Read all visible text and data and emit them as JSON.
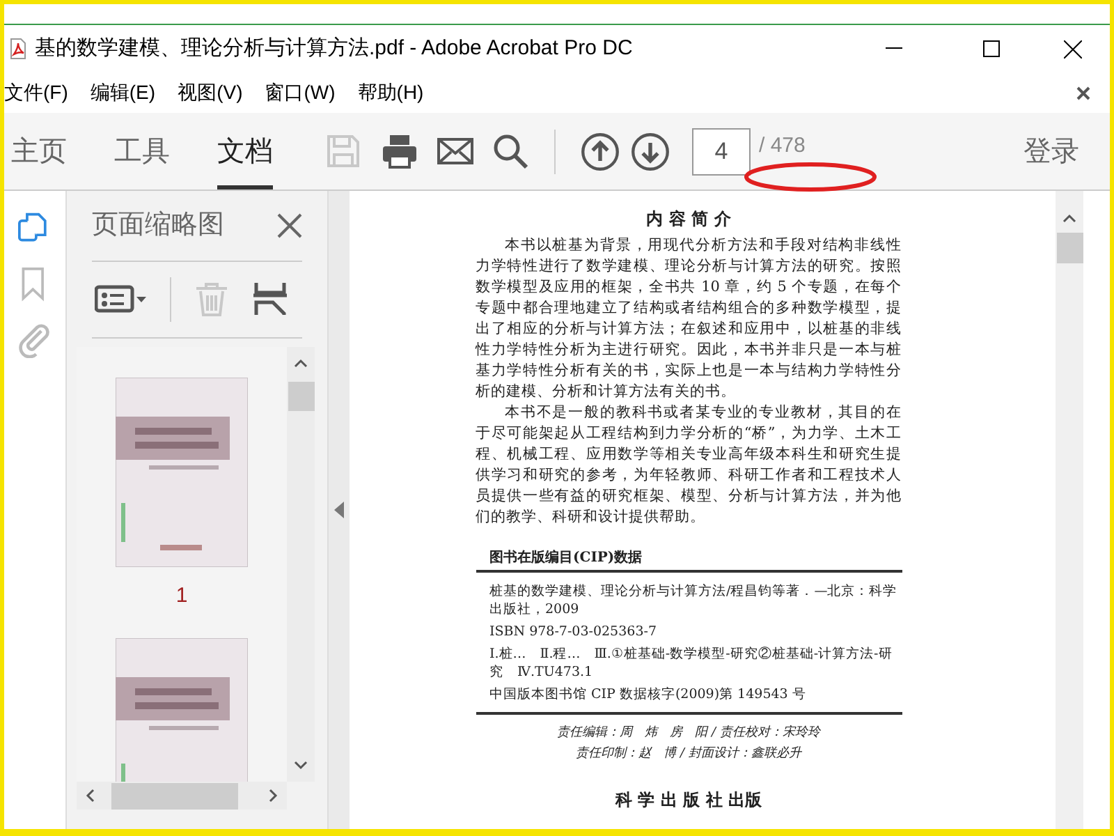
{
  "window": {
    "title": "基的数学建模、理论分析与计算方法.pdf - Adobe Acrobat Pro DC"
  },
  "menu": [
    {
      "label": "文件(F)"
    },
    {
      "label": "编辑(E)"
    },
    {
      "label": "视图(V)"
    },
    {
      "label": "窗口(W)"
    },
    {
      "label": "帮助(H)"
    }
  ],
  "toolbar": {
    "tabs": [
      {
        "label": "主页",
        "selected": false
      },
      {
        "label": "工具",
        "selected": false
      },
      {
        "label": "文档",
        "selected": true
      }
    ],
    "tools": [
      {
        "kind": "save",
        "disabled": true
      },
      {
        "kind": "print",
        "disabled": false
      },
      {
        "kind": "mail",
        "disabled": false
      },
      {
        "kind": "search",
        "disabled": false
      }
    ],
    "nav": [
      {
        "kind": "up"
      },
      {
        "kind": "down"
      }
    ],
    "page": {
      "current": "4",
      "total": "/ 478"
    },
    "sign_in": "登录"
  },
  "side_rail": [
    {
      "kind": "pages",
      "selected": true
    },
    {
      "kind": "bookmarks",
      "selected": false
    },
    {
      "kind": "attachments",
      "selected": false
    }
  ],
  "thumbnails_panel": {
    "title": "页面缩略图",
    "tools": [
      {
        "kind": "options",
        "disabled": false
      },
      {
        "kind": "delete",
        "disabled": true
      },
      {
        "kind": "extract",
        "disabled": false
      }
    ],
    "thumbnails": [
      {
        "kind": "picture",
        "label": "1"
      },
      {
        "kind": "picture"
      }
    ]
  },
  "document": {
    "heading": "内 容 简 介",
    "paragraphs": [
      "本书以桩基为背景，用现代分析方法和手段对结构非线性力学特性进行了数学建模、理论分析与计算方法的研究。按照数学模型及应用的框架，全书共 10 章，约 5 个专题，在每个专题中都合理地建立了结构或者结构组合的多种数学模型，提出了相应的分析与计算方法；在叙述和应用中，以桩基的非线性力学特性分析为主进行研究。因此，本书并非只是一本与桩基力学特性分析有关的书，实际上也是一本与结构力学特性分析的建模、分析和计算方法有关的书。",
      "本书不是一般的教科书或者某专业的专业教材，其目的在于尽可能架起从工程结构到力学分析的“桥”，为力学、土木工程、机械工程、应用数学等相关专业高年级本科生和研究生提供学习和研究的参考，为年轻教师、科研工作者和工程技术人员提供一些有益的研究框架、模型、分析与计算方法，并为他们的教学、科研和设计提供帮助。"
    ],
    "cip": {
      "title": "图书在版编目(CIP)数据",
      "lines": [
        "桩基的数学建模、理论分析与计算方法/程昌钧等著．—北京：科学出版社，2009",
        "ISBN 978-7-03-025363-7",
        "Ⅰ.桩…　Ⅱ.程…　Ⅲ.①桩基础-数学模型-研究②桩基础-计算方法-研究　Ⅳ.TU473.1",
        "中国版本图书馆 CIP 数据核字(2009)第 149543 号"
      ]
    },
    "credits": [
      "责任编辑：周　炜　房　阳 / 责任校对：宋玲玲",
      "责任印制：赵　博 / 封面设计：鑫联必升"
    ],
    "publisher": "科 学 出 版 社 出版"
  }
}
